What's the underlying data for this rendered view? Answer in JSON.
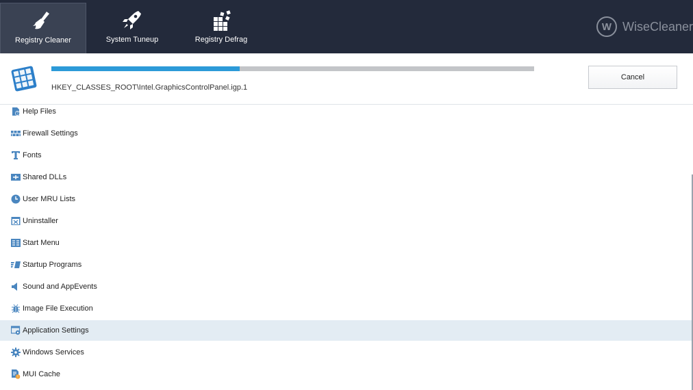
{
  "nav": {
    "items": [
      {
        "label": "Registry Cleaner",
        "icon": "broom-icon",
        "active": true
      },
      {
        "label": "System Tuneup",
        "icon": "rocket-icon",
        "active": false
      },
      {
        "label": "Registry Defrag",
        "icon": "defrag-blocks-icon",
        "active": false
      }
    ]
  },
  "brand": {
    "logo_letter": "W",
    "name": "WiseCleaner"
  },
  "scan": {
    "progress_percent": 39,
    "current_key": "HKEY_CLASSES_ROOT\\Intel.GraphicsControlPanel.igp.1",
    "cancel_label": "Cancel"
  },
  "categories": [
    {
      "label": "Help Files",
      "icon": "help-file-icon"
    },
    {
      "label": "Firewall Settings",
      "icon": "firewall-icon"
    },
    {
      "label": "Fonts",
      "icon": "font-icon"
    },
    {
      "label": "Shared DLLs",
      "icon": "shared-dll-icon"
    },
    {
      "label": "User MRU Lists",
      "icon": "clock-icon"
    },
    {
      "label": "Uninstaller",
      "icon": "uninstaller-icon"
    },
    {
      "label": "Start Menu",
      "icon": "start-menu-icon"
    },
    {
      "label": "Startup Programs",
      "icon": "startup-icon"
    },
    {
      "label": "Sound and AppEvents",
      "icon": "speaker-icon"
    },
    {
      "label": "Image File Execution",
      "icon": "bug-icon"
    },
    {
      "label": "Application Settings",
      "icon": "app-settings-icon",
      "selected": true
    },
    {
      "label": "Windows Services",
      "icon": "gear-icon"
    },
    {
      "label": "MUI Cache",
      "icon": "mui-cache-icon"
    }
  ],
  "colors": {
    "topbar": "#232a3b",
    "accent": "#2c9ad8",
    "icon_blue": "#3a7fc1",
    "selected_row": "#e3ecf3"
  }
}
